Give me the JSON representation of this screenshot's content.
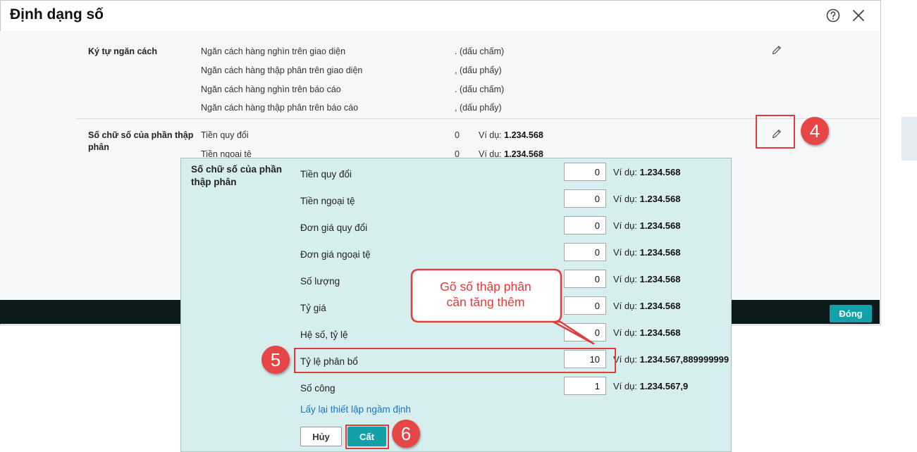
{
  "dialog": {
    "title": "Định dạng số",
    "close_button": "Đóng"
  },
  "separators": {
    "group_label": "Ký tự ngăn cách",
    "rows": [
      {
        "label": "Ngăn cách hàng nghìn trên giao diện",
        "value": ". (dấu chấm)"
      },
      {
        "label": "Ngăn cách hàng thập phân trên giao diện",
        "value": ", (dấu phẩy)"
      },
      {
        "label": "Ngăn cách hàng nghìn trên báo cáo",
        "value": ". (dấu chấm)"
      },
      {
        "label": "Ngăn cách hàng thập phân trên báo cáo",
        "value": ", (dấu phẩy)"
      }
    ]
  },
  "decimals": {
    "group_label": "Số chữ số của phần thập phân",
    "example_prefix": "Ví dụ:",
    "rows": [
      {
        "label": "Tiền quy đổi",
        "value": "0",
        "example": "1.234.568"
      },
      {
        "label": "Tiền ngoại tệ",
        "value": "0",
        "example": "1.234.568"
      }
    ]
  },
  "popup": {
    "group_label": "Số chữ số của phần thập phân",
    "example_prefix": "Ví dụ:",
    "rows": [
      {
        "label": "Tiền quy đổi",
        "value": "0",
        "example": "1.234.568"
      },
      {
        "label": "Tiền ngoại tệ",
        "value": "0",
        "example": "1.234.568"
      },
      {
        "label": "Đơn giá quy đổi",
        "value": "0",
        "example": "1.234.568"
      },
      {
        "label": "Đơn giá ngoại tệ",
        "value": "0",
        "example": "1.234.568"
      },
      {
        "label": "Số lượng",
        "value": "0",
        "example": "1.234.568"
      },
      {
        "label": "Tỷ giá",
        "value": "0",
        "example": "1.234.568"
      },
      {
        "label": "Hệ số, tỷ lệ",
        "value": "0",
        "example": "1.234.568"
      },
      {
        "label": "Tỷ lệ phân bổ",
        "value": "10",
        "example": "1.234.567,889999999"
      },
      {
        "label": "Số công",
        "value": "1",
        "example": "1.234.567,9"
      }
    ],
    "reset_link": "Lấy lại thiết lập ngầm định",
    "cancel_button": "Hủy",
    "save_button": "Cất"
  },
  "annotations": {
    "callout_line1": "Gõ số thập phân",
    "callout_line2": "cần tăng thêm",
    "step4": "4",
    "step5": "5",
    "step6": "6",
    "color": "#e03c3c"
  },
  "colors": {
    "accent": "#13a1a7",
    "popup_bg": "#d7eeef",
    "footer_bg": "#0c1a1c",
    "link": "#1976c8"
  }
}
